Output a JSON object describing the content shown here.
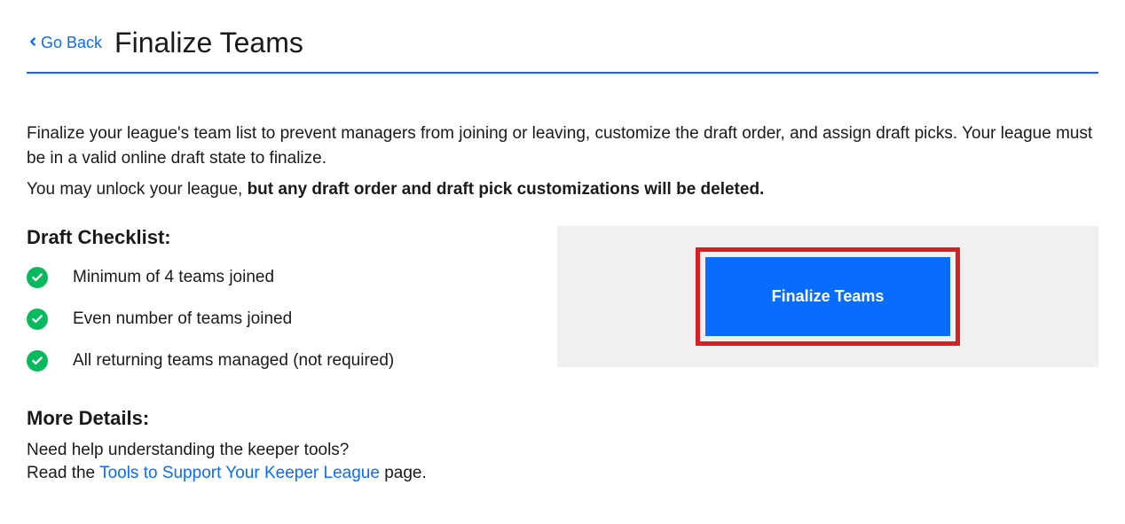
{
  "header": {
    "go_back_label": "Go Back",
    "page_title": "Finalize Teams"
  },
  "intro": {
    "p1": "Finalize your league's team list to prevent managers from joining or leaving, customize the draft order, and assign draft picks. Your league must be in a valid online draft state to finalize.",
    "p2_prefix": "You may unlock your league, ",
    "p2_bold": "but any draft order and draft pick customizations will be deleted."
  },
  "checklist": {
    "heading": "Draft Checklist:",
    "items": [
      {
        "text": "Minimum of 4 teams joined"
      },
      {
        "text": "Even number of teams joined"
      },
      {
        "text": "All returning teams managed (not required)"
      }
    ]
  },
  "more_details": {
    "heading": "More Details:",
    "line1": "Need help understanding the keeper tools?",
    "line2_prefix": "Read the ",
    "line2_link": "Tools to Support Your Keeper League",
    "line2_suffix": " page."
  },
  "action": {
    "finalize_button": "Finalize Teams"
  }
}
